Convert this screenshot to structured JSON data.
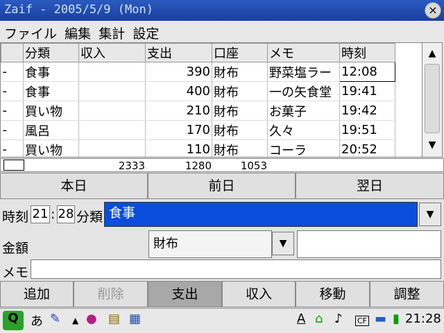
{
  "window": {
    "title": "Zaif - 2005/5/9 (Mon)",
    "close_glyph": "×"
  },
  "menu": [
    "ファイル",
    "編集",
    "集計",
    "設定"
  ],
  "table": {
    "headers": [
      "",
      "分類",
      "収入",
      "支出",
      "口座",
      "メモ",
      "時刻"
    ],
    "rows": [
      [
        "-",
        "食事",
        "",
        "390",
        "財布",
        "野菜塩ラー",
        "12:08"
      ],
      [
        "-",
        "食事",
        "",
        "400",
        "財布",
        "一の矢食堂",
        "19:41"
      ],
      [
        "-",
        "買い物",
        "",
        "210",
        "財布",
        "お菓子",
        "19:42"
      ],
      [
        "-",
        "風呂",
        "",
        "170",
        "財布",
        "久々",
        "19:51"
      ],
      [
        "-",
        "買い物",
        "",
        "110",
        "財布",
        "コーラ",
        "20:52"
      ]
    ],
    "totals": [
      "2333",
      "1280",
      "1053"
    ]
  },
  "nav": {
    "today": "本日",
    "prev": "前日",
    "next": "翌日"
  },
  "form": {
    "time_label": "時刻",
    "hour": "21",
    "sep": ":",
    "minute": "28",
    "category_label": "分類",
    "category_value": "食事",
    "amount_label": "金額",
    "account_value": "財布",
    "memo_label": "メモ"
  },
  "actions": {
    "add": "追加",
    "delete": "削除",
    "expense": "支出",
    "income": "収入",
    "move": "移動",
    "adjust": "調整"
  },
  "taskbar": {
    "input_mode": "あ",
    "clock": "21:28"
  }
}
